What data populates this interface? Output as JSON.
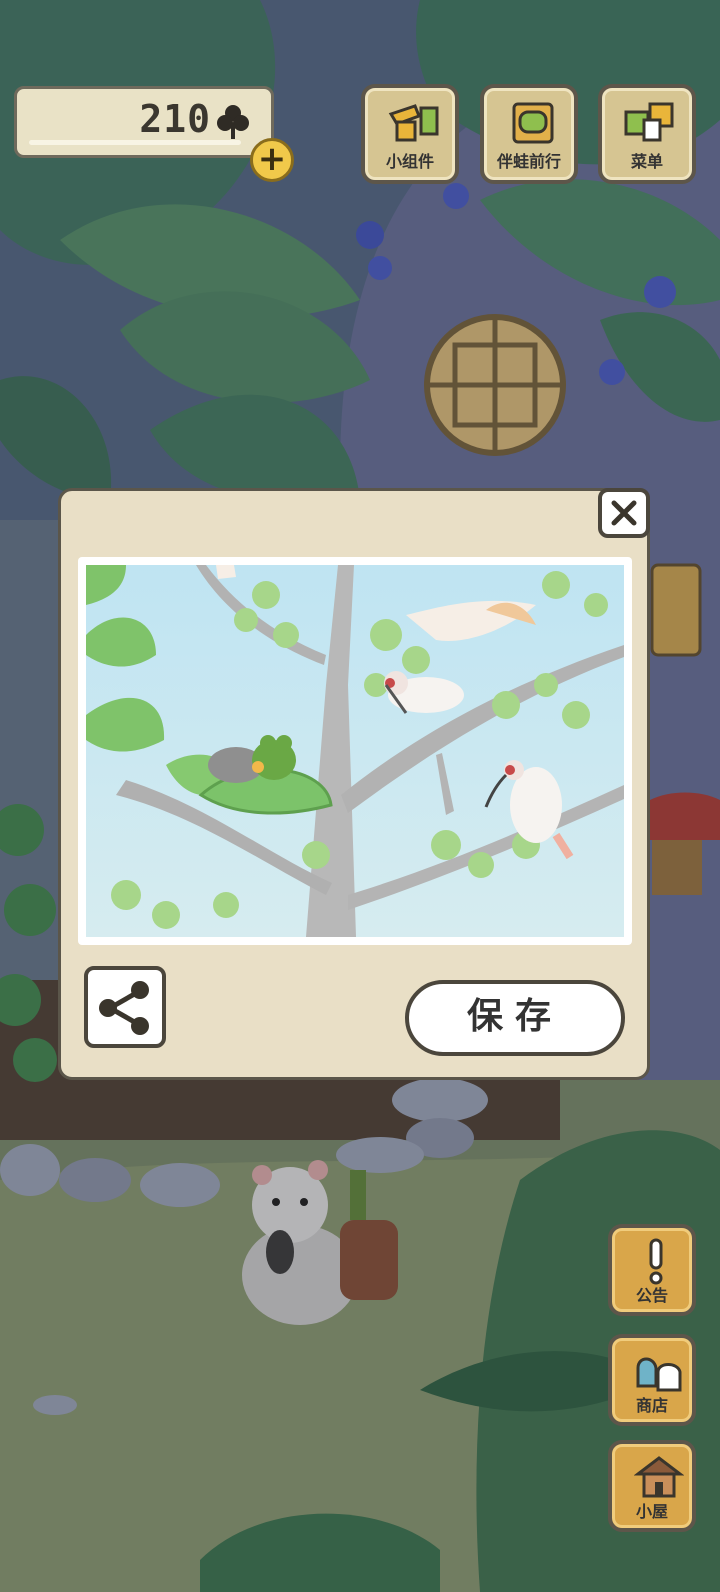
{
  "currency": {
    "clover_count": "210",
    "clover_icon": "clover-icon",
    "add_icon": "plus-icon"
  },
  "top_menu": {
    "widgets_label": "小组件",
    "travel_with_frog_label": "伴蛙前行",
    "menu_label": "菜单"
  },
  "side_menu": {
    "notice_label": "公告",
    "shop_label": "商店",
    "house_label": "小屋"
  },
  "photo_popup": {
    "save_label": "保存",
    "share_icon": "share-icon",
    "close_icon": "close-icon"
  },
  "colors": {
    "button_tan": "#d6c592",
    "side_button_orange": "#d9a64a",
    "popup_bg": "#e9dfc6",
    "border_dark": "#4b463c"
  }
}
